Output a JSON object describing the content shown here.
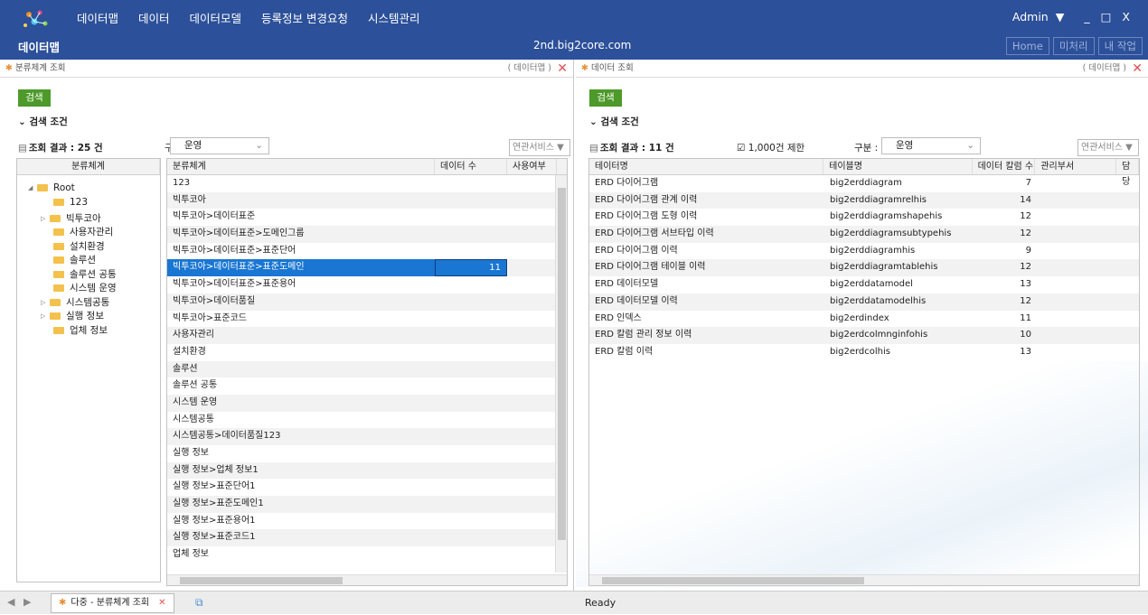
{
  "header": {
    "menu": [
      "데이터맵",
      "데이터",
      "데이터모델",
      "등록정보 변경요청",
      "시스템관리"
    ],
    "brand": "데이터맵",
    "host": "2nd.big2core.com",
    "user": "Admin",
    "window_controls": [
      "▼",
      "_",
      "□",
      "X"
    ],
    "buttons": [
      "Home",
      "미처리",
      "내 작업"
    ]
  },
  "left": {
    "title": "분류체계 조회",
    "context": "( 데이터맵 )",
    "search_button": "검색",
    "condition_label": "검색 조건",
    "result_label": "조회 결과 :",
    "result_count": "25",
    "result_unit": "건",
    "div_label": "구분 :",
    "div_value": "운영",
    "service_button": "연관서비스 ▼",
    "tree": {
      "header": "분류체계",
      "items": [
        "Root",
        "123",
        "빅투코아",
        "사용자관리",
        "설치환경",
        "솔루션",
        "솔루션 공통",
        "시스템 운영",
        "시스템공통",
        "실행 정보",
        "업체 정보"
      ]
    },
    "grid": {
      "columns": [
        "분류체계",
        "데이터 수",
        "사용여부"
      ],
      "rows": [
        [
          "123",
          "",
          ""
        ],
        [
          "빅투코아",
          "",
          ""
        ],
        [
          "빅투코아>데이터표준",
          "",
          ""
        ],
        [
          "빅투코아>데이터표준>도메인그룹",
          "",
          ""
        ],
        [
          "빅투코아>데이터표준>표준단어",
          "",
          ""
        ],
        [
          "빅투코아>데이터표준>표준도메인",
          "11",
          ""
        ],
        [
          "빅투코아>데이터표준>표준용어",
          "",
          ""
        ],
        [
          "빅투코아>데이터품질",
          "",
          ""
        ],
        [
          "빅투코아>표준코드",
          "",
          ""
        ],
        [
          "사용자관리",
          "",
          ""
        ],
        [
          "설치환경",
          "",
          ""
        ],
        [
          "솔루션",
          "",
          ""
        ],
        [
          "솔루션 공통",
          "",
          ""
        ],
        [
          "시스템 운영",
          "",
          ""
        ],
        [
          "시스템공통",
          "",
          ""
        ],
        [
          "시스템공통>데이터품질123",
          "",
          ""
        ],
        [
          "실행 정보",
          "",
          ""
        ],
        [
          "실행 정보>업체 정보1",
          "",
          ""
        ],
        [
          "실행 정보>표준단어1",
          "",
          ""
        ],
        [
          "실행 정보>표준도메인1",
          "",
          ""
        ],
        [
          "실행 정보>표준용어1",
          "",
          ""
        ],
        [
          "실행 정보>표준코드1",
          "",
          ""
        ],
        [
          "업체 정보",
          "",
          ""
        ]
      ]
    }
  },
  "right": {
    "title": "데이터 조회",
    "context": "( 데이터맵 )",
    "search_button": "검색",
    "condition_label": "검색 조건",
    "result_label": "조회 결과 :",
    "result_count": "11",
    "result_unit": "건",
    "limit_label": "1,000건 제한",
    "div_label": "구분 :",
    "div_value": "운영",
    "service_button": "연관서비스 ▼",
    "grid": {
      "columns": [
        "테이터명",
        "테이블명",
        "데이터 칼럼 수",
        "관리부서",
        "담당"
      ],
      "rows": [
        [
          "ERD 다이어그램",
          "big2erddiagram",
          "7"
        ],
        [
          "ERD 다이어그램 관계 이력",
          "big2erddiagramrelhis",
          "14"
        ],
        [
          "ERD 다이어그램 도형 이력",
          "big2erddiagramshapehis",
          "12"
        ],
        [
          "ERD 다이어그램 서브타입 이력",
          "big2erddiagramsubtypehis",
          "12"
        ],
        [
          "ERD 다이어그램 이력",
          "big2erddiagramhis",
          "9"
        ],
        [
          "ERD 다이어그램 테이블 이력",
          "big2erddiagramtablehis",
          "12"
        ],
        [
          "ERD 데이터모델",
          "big2erddatamodel",
          "13"
        ],
        [
          "ERD 데이터모델 이력",
          "big2erddatamodelhis",
          "12"
        ],
        [
          "ERD 인덱스",
          "big2erdindex",
          "11"
        ],
        [
          "ERD 칼럼 관리 정보 이력",
          "big2erdcolmnginfohis",
          "10"
        ],
        [
          "ERD 칼럼 이력",
          "big2erdcolhis",
          "13"
        ]
      ]
    }
  },
  "bottom": {
    "tab_label": "다중 - 분류체계 조회",
    "status": "Ready"
  }
}
